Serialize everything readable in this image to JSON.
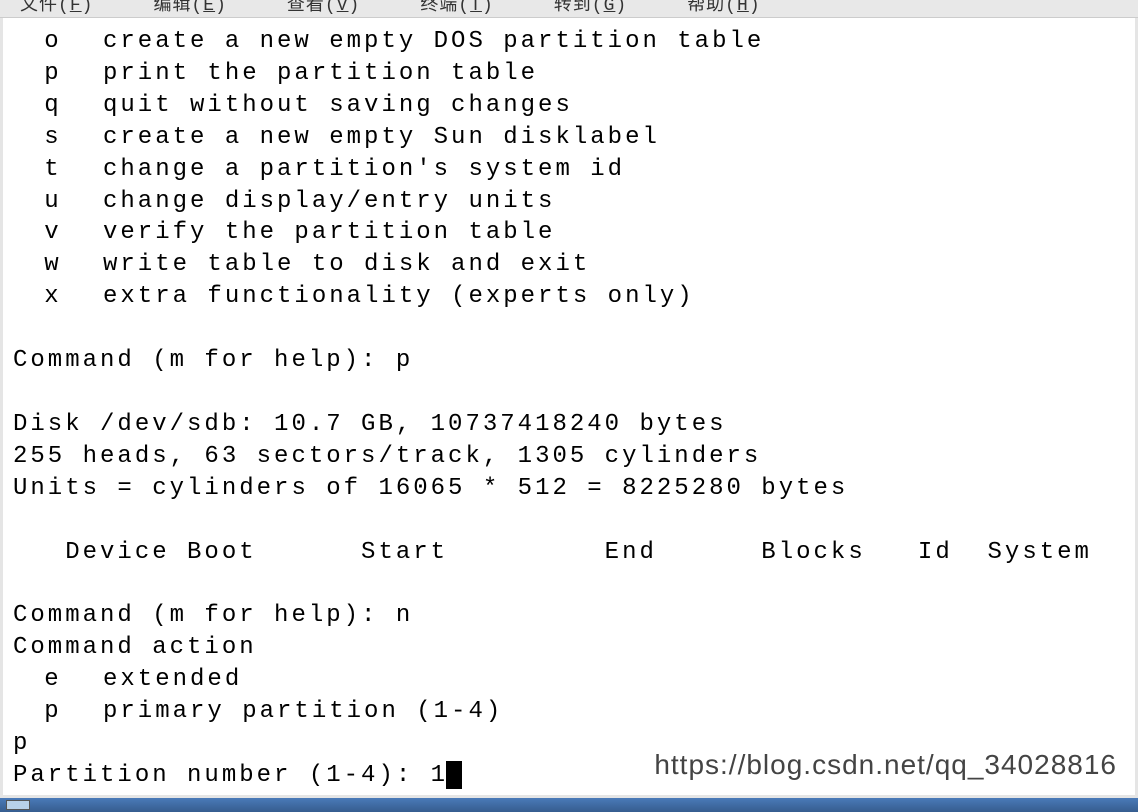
{
  "menubar": {
    "file": {
      "label_pre": "文件(",
      "key": "F",
      "label_post": ")"
    },
    "edit": {
      "label_pre": "编辑(",
      "key": "E",
      "label_post": ")"
    },
    "view": {
      "label_pre": "查看(",
      "key": "V",
      "label_post": ")"
    },
    "terminal": {
      "label_pre": "终端(",
      "key": "T",
      "label_post": ")"
    },
    "go": {
      "label_pre": "转到(",
      "key": "G",
      "label_post": ")"
    },
    "help": {
      "label_pre": "帮助(",
      "key": "H",
      "label_post": ")"
    }
  },
  "help_commands": [
    {
      "key": "o",
      "desc": "create a new empty DOS partition table"
    },
    {
      "key": "p",
      "desc": "print the partition table"
    },
    {
      "key": "q",
      "desc": "quit without saving changes"
    },
    {
      "key": "s",
      "desc": "create a new empty Sun disklabel"
    },
    {
      "key": "t",
      "desc": "change a partition's system id"
    },
    {
      "key": "u",
      "desc": "change display/entry units"
    },
    {
      "key": "v",
      "desc": "verify the partition table"
    },
    {
      "key": "w",
      "desc": "write table to disk and exit"
    },
    {
      "key": "x",
      "desc": "extra functionality (experts only)"
    }
  ],
  "session": {
    "prompt1_label": "Command (m for help): ",
    "prompt1_input": "p",
    "disk_line1": "Disk /dev/sdb: 10.7 GB, 10737418240 bytes",
    "disk_line2": "255 heads, 63 sectors/track, 1305 cylinders",
    "disk_line3": "Units = cylinders of 16065 * 512 = 8225280 bytes",
    "table_header": "   Device Boot      Start         End      Blocks   Id  System",
    "prompt2_label": "Command (m for help): ",
    "prompt2_input": "n",
    "cmd_action_label": "Command action",
    "action_e_key": "e",
    "action_e_desc": "extended",
    "action_p_key": "p",
    "action_p_desc": "primary partition (1-4)",
    "choice": "p",
    "partnum_label": "Partition number (1-4): ",
    "partnum_input": "1"
  },
  "watermark": "https://blog.csdn.net/qq_34028816"
}
